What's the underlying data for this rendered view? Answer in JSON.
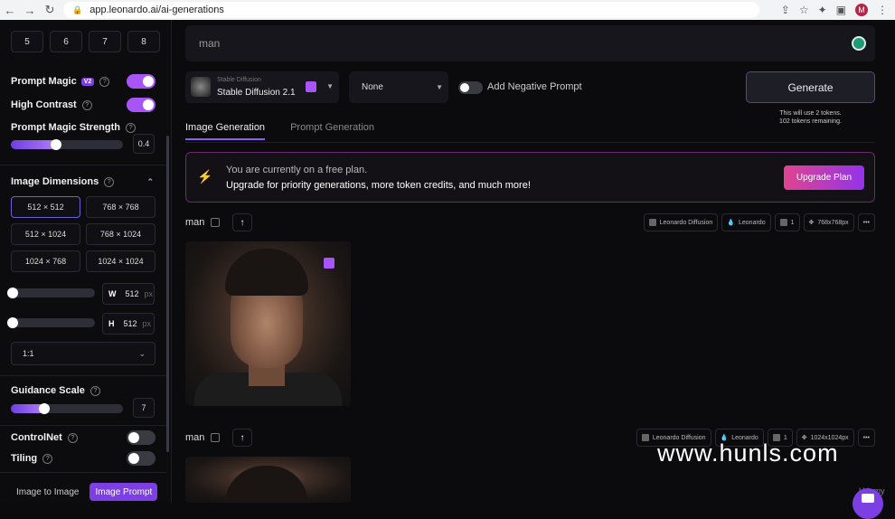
{
  "browser": {
    "url": "app.leonardo.ai/ai-generations",
    "avatar_initial": "M"
  },
  "sidebar": {
    "num_images": [
      "5",
      "6",
      "7",
      "8"
    ],
    "prompt_magic": {
      "label": "Prompt Magic",
      "badge": "V2",
      "enabled": true
    },
    "high_contrast": {
      "label": "High Contrast",
      "enabled": true
    },
    "prompt_magic_strength": {
      "label": "Prompt Magic Strength",
      "value": "0.4",
      "fraction": 0.4
    },
    "image_dimensions": {
      "label": "Image Dimensions",
      "options": [
        "512 × 512",
        "768 × 768",
        "512 × 1024",
        "768 × 1024",
        "1024 × 768",
        "1024 × 1024"
      ],
      "selected": "512 × 512"
    },
    "width": {
      "label": "W",
      "value": "512",
      "unit": "px"
    },
    "height": {
      "label": "H",
      "value": "512",
      "unit": "px"
    },
    "aspect_ratio": "1:1",
    "guidance_scale": {
      "label": "Guidance Scale",
      "value": "7",
      "fraction": 0.3
    },
    "controlnet": {
      "label": "ControlNet",
      "enabled": false
    },
    "tiling": {
      "label": "Tiling",
      "enabled": false
    },
    "bottom_tabs": [
      "Image to Image",
      "Image Prompt"
    ]
  },
  "main": {
    "prompt": "man",
    "model": {
      "subtitle": "Stable Diffusion",
      "name": "Stable Diffusion 2.1"
    },
    "style_select": "None",
    "negative_prompt_label": "Add Negative Prompt",
    "generate_label": "Generate",
    "token_info_1": "This will use 2 tokens.",
    "token_info_2": "102 tokens remaining.",
    "tabs": [
      "Image Generation",
      "Prompt Generation"
    ],
    "banner": {
      "line1": "You are currently on a free plan.",
      "line2": "Upgrade for priority generations, more token credits, and much more!",
      "button": "Upgrade Plan"
    },
    "generations": [
      {
        "title": "man",
        "model": "Leonardo Diffusion",
        "preset": "Leonardo",
        "count": "1",
        "size": "768x768px"
      },
      {
        "title": "man",
        "model": "Leonardo Diffusion",
        "preset": "Leonardo",
        "count": "1",
        "size": "1024x1024px"
      }
    ]
  },
  "overlay": {
    "watermark": "www.hunls.com",
    "udemy": "Udemy"
  }
}
